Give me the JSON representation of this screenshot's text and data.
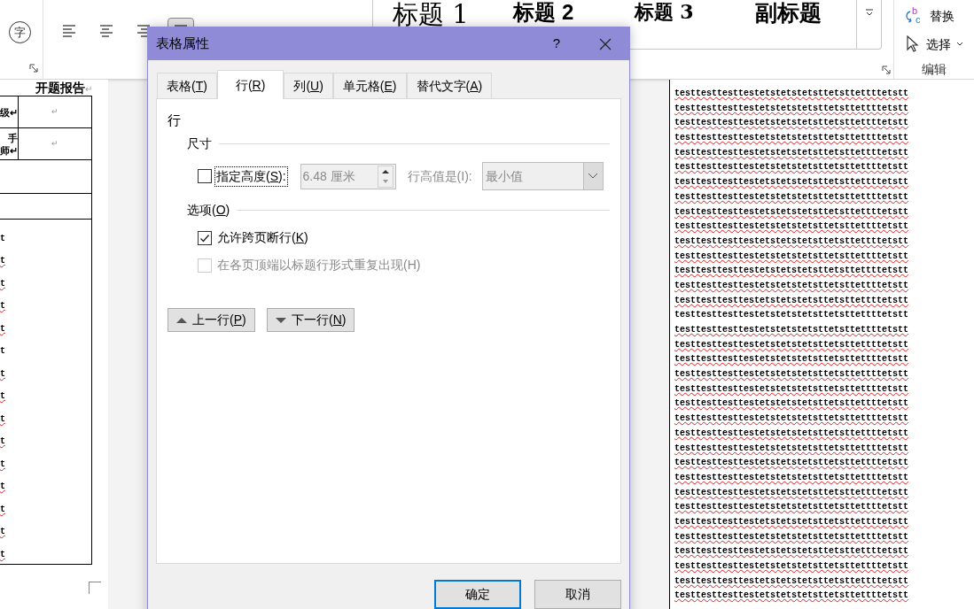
{
  "ribbon": {
    "phonetic_guide": {
      "char": "字"
    },
    "alignment": [
      {
        "kind": "left",
        "selected": false
      },
      {
        "kind": "center",
        "selected": false
      },
      {
        "kind": "right",
        "selected": false
      },
      {
        "kind": "justify",
        "selected": true
      }
    ],
    "styles": [
      {
        "label": "标题 1",
        "kind": "heading1"
      },
      {
        "label": "标题 2",
        "kind": "heading2"
      },
      {
        "label": "标题 3",
        "kind": "heading3"
      },
      {
        "label": "副标题",
        "kind": "subtitle"
      }
    ],
    "editing": {
      "items": [
        {
          "label": "替换",
          "kind": "replace",
          "icon_letters": [
            "b",
            "c"
          ]
        },
        {
          "label": "选择",
          "kind": "select"
        }
      ],
      "group_label": "编辑"
    }
  },
  "left_document": {
    "heading": "开题报告",
    "heading_mark": "↵",
    "table_rows": [
      {
        "label_lines": [
          "级↵"
        ],
        "value": "↵"
      },
      {
        "label_lines": [
          "手",
          "师↵"
        ],
        "value": "↵"
      }
    ],
    "lines": [
      {
        "text": "t",
        "spell_error": false
      },
      {
        "text": "t",
        "spell_error": true
      },
      {
        "text": "t",
        "spell_error": true
      },
      {
        "text": "t",
        "spell_error": true
      },
      {
        "text": "t",
        "spell_error": true
      },
      {
        "text": "t",
        "spell_error": false
      },
      {
        "text": "t",
        "spell_error": true
      },
      {
        "text": "t",
        "spell_error": true
      },
      {
        "text": "t",
        "spell_error": true
      },
      {
        "text": "t",
        "spell_error": true
      },
      {
        "text": "t",
        "spell_error": true
      },
      {
        "text": "t",
        "spell_error": true
      },
      {
        "text": "t",
        "spell_error": true
      },
      {
        "text": "t",
        "spell_error": true
      },
      {
        "text": "t",
        "spell_error": true
      }
    ]
  },
  "right_document": {
    "lines": [
      {
        "text": "testtesttesttestetstetstetsttetsttettttetstt",
        "spell_error": true
      },
      {
        "text": "testtesttesttestetstetstetsttetsttettttetstt",
        "spell_error": true
      },
      {
        "text": "testtesttesttestetstetstetsttetsttettttetstt",
        "spell_error": true
      },
      {
        "text": "testtesttesttestetstetstetsttetsttettttetstt",
        "spell_error": true
      },
      {
        "text": "testtesttesttestetstetstetsttetsttettttetstt",
        "spell_error": true
      },
      {
        "text": "testtesttesttestetstetstetsttetsttettttetstt",
        "spell_error": true
      },
      {
        "text": "testtesttesttestetstetstetsttetsttettttetstt",
        "spell_error": true
      },
      {
        "text": "testtesttesttestetstetstetsttetsttettttetstt",
        "spell_error": true
      },
      {
        "text": "testtesttesttestetstetstetsttetsttettttetstt",
        "spell_error": true
      },
      {
        "text": "testtesttesttestetstetstetsttetsttettttetstt",
        "spell_error": true
      },
      {
        "text": "testtesttesttestetstetstetsttetsttettttetstt",
        "spell_error": true
      },
      {
        "text": "testtesttesttestetstetstetsttetsttettttetstt",
        "spell_error": true
      },
      {
        "text": "testtesttesttestetstetstetsttetsttettttetstt",
        "spell_error": true
      },
      {
        "text": "testtesttesttestetstetstetsttetsttettttetstt",
        "spell_error": true
      },
      {
        "text": "testtesttesttestetstetstetsttetsttettttetstt",
        "spell_error": true
      },
      {
        "text": "testtesttesttestetstetstetsttetsttettttetstt",
        "spell_error": false
      },
      {
        "text": "testtesttesttestetstetstetsttetsttettttetstt",
        "spell_error": true
      },
      {
        "text": "testtesttesttestetstetstetsttetsttettttetstt",
        "spell_error": true
      },
      {
        "text": "testtesttesttestetstetstetsttetsttettttetstt",
        "spell_error": true
      },
      {
        "text": "testtesttesttestetstetstetsttetsttettttetstt",
        "spell_error": true
      },
      {
        "text": "testtesttesttestetstetstetsttetsttettttetstt",
        "spell_error": true
      },
      {
        "text": "testtesttesttestetstetstetsttetsttettttetstt",
        "spell_error": true
      },
      {
        "text": "testtesttesttestetstetstetsttetsttettttetstt",
        "spell_error": true
      },
      {
        "text": "testtesttesttestetstetstetsttetsttettttetstt",
        "spell_error": true
      },
      {
        "text": "testtesttesttestetstetstetsttetsttettttetstt",
        "spell_error": true
      },
      {
        "text": "testtesttesttestetstetstetsttetsttettttetstt",
        "spell_error": true
      },
      {
        "text": "testtesttesttestetstetstetsttetsttettttetstt",
        "spell_error": true
      },
      {
        "text": "testtesttesttestetstetstetsttetsttettttetstt",
        "spell_error": true
      },
      {
        "text": "testtesttesttestetstetstetsttetsttettttetstt",
        "spell_error": true
      },
      {
        "text": "testtesttesttestetstetstetsttetsttettttetstt",
        "spell_error": true
      },
      {
        "text": "testtesttesttestetstetstetsttetsttettttetstt",
        "spell_error": true
      },
      {
        "text": "testtesttesttestetstetstetsttetsttettttetstt",
        "spell_error": true
      },
      {
        "text": "testtesttesttestetstetstetsttetsttettttetstt",
        "spell_error": true
      },
      {
        "text": "testtesttesttestetstetstetsttetsttettttetstt",
        "spell_error": true
      },
      {
        "text": "testtesttesttestetstetstetsttetsttettttetstt",
        "spell_error": true
      }
    ]
  },
  "dialog": {
    "title": "表格属性",
    "help": "?",
    "tabs": [
      {
        "label": [
          "表格(",
          "T",
          ")"
        ],
        "selected": false
      },
      {
        "label": [
          "行(",
          "R",
          ")"
        ],
        "selected": true
      },
      {
        "label": [
          "列(",
          "U",
          ")"
        ],
        "selected": false
      },
      {
        "label": [
          "单元格(",
          "E",
          ")"
        ],
        "selected": false
      },
      {
        "label": [
          "替代文字(",
          "A",
          ")"
        ],
        "selected": false
      }
    ],
    "section": "行",
    "size_group": {
      "title": "尺寸"
    },
    "specify_height": {
      "label": [
        "指定高度(",
        "S",
        "):"
      ],
      "checked": false,
      "focused": true
    },
    "height_field": {
      "value": "6.48 厘米",
      "disabled": true
    },
    "height_rule": {
      "label": "行高值是(I):",
      "value": "最小值",
      "disabled": true
    },
    "options_group": {
      "title": [
        "选项(",
        "O",
        ")"
      ]
    },
    "options": [
      {
        "label": [
          "允许跨页断行(",
          "K",
          ")"
        ],
        "checked": true,
        "disabled": false
      },
      {
        "label": [
          "在各页顶端以标题行形式重复出现(H)"
        ],
        "checked": false,
        "disabled": true
      }
    ],
    "nav_buttons": [
      {
        "label": [
          "上一行(",
          "P",
          ")"
        ],
        "kind": "up"
      },
      {
        "label": [
          "下一行(",
          "N",
          ")"
        ],
        "kind": "down"
      }
    ],
    "footer_buttons": [
      {
        "label": "确定",
        "default": true
      },
      {
        "label": "取消",
        "default": false
      }
    ]
  }
}
